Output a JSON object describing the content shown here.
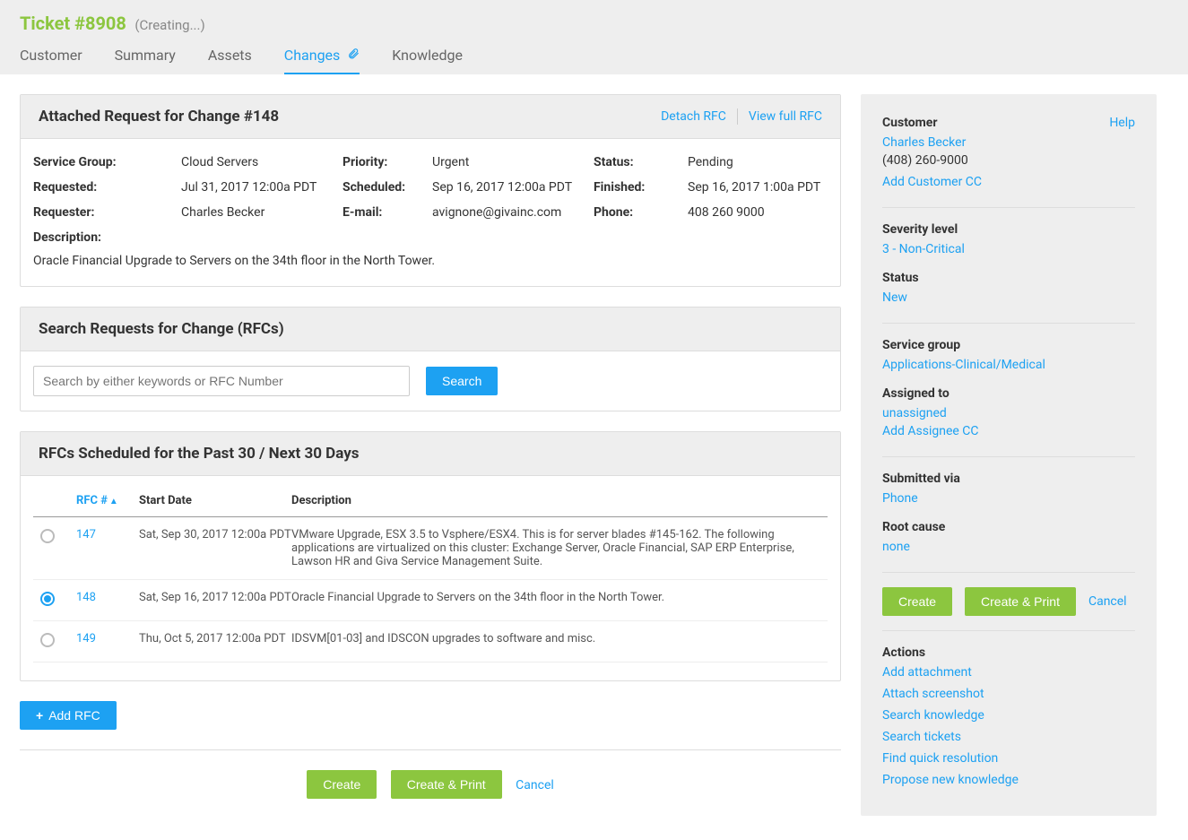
{
  "header": {
    "title": "Ticket #8908",
    "status_text": "(Creating...)",
    "tabs": [
      "Customer",
      "Summary",
      "Assets",
      "Changes",
      "Knowledge"
    ],
    "active_tab_index": 3
  },
  "attached_rfc": {
    "panel_title": "Attached Request for Change #148",
    "detach_label": "Detach RFC",
    "view_full_label": "View full RFC",
    "fields": {
      "service_group_label": "Service Group:",
      "service_group": "Cloud Servers",
      "priority_label": "Priority:",
      "priority": "Urgent",
      "status_label": "Status:",
      "status": "Pending",
      "requested_label": "Requested:",
      "requested": "Jul 31, 2017 12:00a PDT",
      "scheduled_label": "Scheduled:",
      "scheduled": "Sep 16, 2017 12:00a PDT",
      "finished_label": "Finished:",
      "finished": "Sep 16, 2017 1:00a PDT",
      "requester_label": "Requester:",
      "requester": "Charles Becker",
      "email_label": "E-mail:",
      "email": "avignone@givainc.com",
      "phone_label": "Phone:",
      "phone": "408 260 9000",
      "description_label": "Description:",
      "description": "Oracle Financial Upgrade to Servers on the 34th floor in the North Tower."
    }
  },
  "search_panel": {
    "title": "Search Requests for Change (RFCs)",
    "placeholder": "Search by either keywords or RFC Number",
    "button_label": "Search"
  },
  "scheduled_panel": {
    "title": "RFCs Scheduled for the Past 30 / Next 30 Days",
    "columns": {
      "rfc": "RFC #",
      "start": "Start Date",
      "desc": "Description"
    },
    "rows": [
      {
        "id": "147",
        "start": "Sat, Sep 30, 2017 12:00a PDT",
        "desc": "VMware Upgrade, ESX 3.5 to Vsphere/ESX4. This is for server blades #145-162. The following applications are virtualized on this cluster: Exchange Server, Oracle Financial, SAP ERP Enterprise, Lawson HR and Giva Service Management Suite.",
        "selected": false
      },
      {
        "id": "148",
        "start": "Sat, Sep 16, 2017 12:00a PDT",
        "desc": "Oracle Financial Upgrade to Servers on the 34th floor in the North Tower.",
        "selected": true
      },
      {
        "id": "149",
        "start": "Thu, Oct 5, 2017 12:00a PDT",
        "desc": "IDSVM[01-03] and IDSCON upgrades to software and misc.",
        "selected": false
      }
    ]
  },
  "buttons": {
    "add_rfc": "Add RFC",
    "create": "Create",
    "create_print": "Create & Print",
    "cancel": "Cancel"
  },
  "sidebar": {
    "customer_label": "Customer",
    "help_label": "Help",
    "customer_name": "Charles Becker",
    "customer_phone": "(408) 260-9000",
    "add_customer_cc": "Add Customer CC",
    "severity_label": "Severity level",
    "severity_value": "3 - Non-Critical",
    "status_label": "Status",
    "status_value": "New",
    "service_group_label": "Service group",
    "service_group_value": "Applications-Clinical/Medical",
    "assigned_label": "Assigned to",
    "assigned_value": "unassigned",
    "add_assignee_cc": "Add Assignee CC",
    "submitted_label": "Submitted via",
    "submitted_value": "Phone",
    "root_cause_label": "Root cause",
    "root_cause_value": "none",
    "actions_label": "Actions",
    "actions": [
      "Add attachment",
      "Attach screenshot",
      "Search knowledge",
      "Search tickets",
      "Find quick resolution",
      "Propose new knowledge"
    ]
  }
}
